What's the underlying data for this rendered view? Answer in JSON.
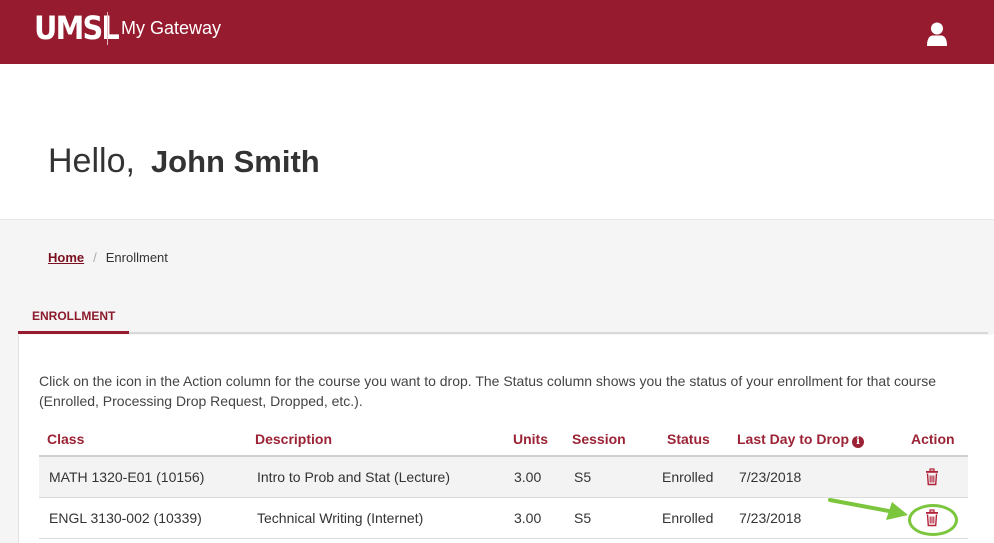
{
  "header": {
    "logo_text": "UMSL",
    "app_title": "My Gateway",
    "user_icon": "user-icon"
  },
  "greeting": {
    "hello": "Hello,",
    "name": "John Smith"
  },
  "breadcrumb": {
    "home": "Home",
    "separator": "/",
    "current": "Enrollment"
  },
  "tabs": [
    {
      "label": "ENROLLMENT",
      "active": true
    }
  ],
  "instructions": "Click on the icon in the Action column for the course you want to drop. The Status column shows you the status of your enrollment for that course (Enrolled, Processing Drop Request, Dropped, etc.).",
  "table": {
    "columns": [
      "Class",
      "Description",
      "Units",
      "Session",
      "Status",
      "Last Day to Drop",
      "Action"
    ],
    "info_icon": "info-circle-icon",
    "action_icon": "trash-icon",
    "rows": [
      {
        "class": "MATH 1320-E01 (10156)",
        "description": "Intro to Prob and Stat (Lecture)",
        "units": "3.00",
        "session": "S5",
        "status": "Enrolled",
        "last_day": "7/23/2018"
      },
      {
        "class": "ENGL 3130-002 (10339)",
        "description": "Technical Writing (Internet)",
        "units": "3.00",
        "session": "S5",
        "status": "Enrolled",
        "last_day": "7/23/2018"
      }
    ]
  },
  "colors": {
    "brand": "#971b2f",
    "header_text": "#9b2335",
    "annotation": "#7cc63e"
  }
}
